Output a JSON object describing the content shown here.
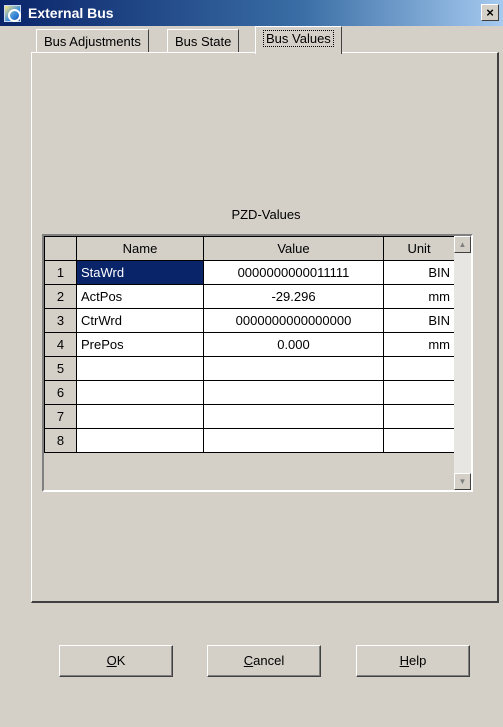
{
  "window": {
    "title": "External Bus",
    "close_label": "×"
  },
  "tabs": [
    {
      "label": "Bus Adjustments",
      "active": false
    },
    {
      "label": "Bus State",
      "active": false
    },
    {
      "label": "Bus Values",
      "active": true
    }
  ],
  "panel": {
    "section_label": "PZD-Values"
  },
  "table": {
    "headers": {
      "index": "",
      "name": "Name",
      "value": "Value",
      "unit": "Unit"
    },
    "rows": [
      {
        "index": "1",
        "name": "StaWrd",
        "value": "0000000000011111",
        "unit": "BIN"
      },
      {
        "index": "2",
        "name": "ActPos",
        "value": "-29.296",
        "unit": "mm"
      },
      {
        "index": "3",
        "name": "CtrWrd",
        "value": "0000000000000000",
        "unit": "BIN"
      },
      {
        "index": "4",
        "name": "PrePos",
        "value": "0.000",
        "unit": "mm"
      },
      {
        "index": "5",
        "name": "",
        "value": "",
        "unit": ""
      },
      {
        "index": "6",
        "name": "",
        "value": "",
        "unit": ""
      },
      {
        "index": "7",
        "name": "",
        "value": "",
        "unit": ""
      },
      {
        "index": "8",
        "name": "",
        "value": "",
        "unit": ""
      }
    ],
    "selected_cell": "rows.0.name"
  },
  "buttons": {
    "ok": {
      "mnemonic": "O",
      "rest": "K"
    },
    "cancel": {
      "mnemonic": "C",
      "rest": "ancel"
    },
    "help": {
      "mnemonic": "H",
      "rest": "elp"
    }
  },
  "colors": {
    "titlebar_start": "#0a246a",
    "titlebar_end": "#a6caf0",
    "face": "#d4d0c8",
    "selection": "#0a246a"
  },
  "icons": {
    "app": "app-icon",
    "close": "close-icon",
    "scroll_up": "scroll-up-arrow-icon",
    "scroll_down": "scroll-down-arrow-icon"
  }
}
